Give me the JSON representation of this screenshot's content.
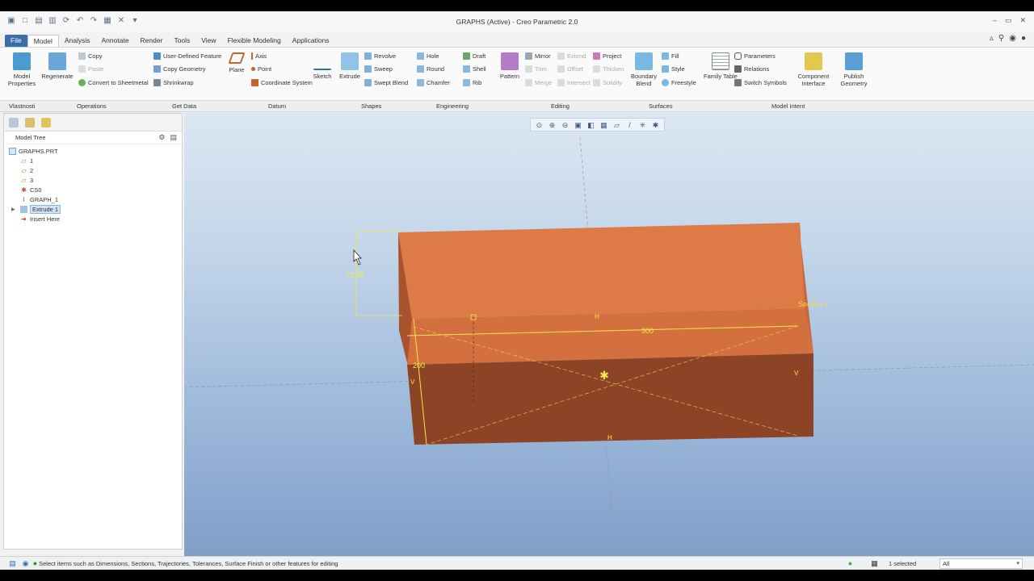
{
  "window": {
    "title": "GRAPHS (Active) - Creo Parametric 2.0"
  },
  "tabs": [
    "File",
    "Model",
    "Analysis",
    "Annotate",
    "Render",
    "Tools",
    "View",
    "Flexible Modeling",
    "Applications"
  ],
  "ribbon": {
    "model_properties": "Model Properties",
    "regenerate": "Regenerate",
    "copy": "Copy",
    "paste": "Paste",
    "user_defined_feature": "User-Defined Feature",
    "copy_geometry": "Copy Geometry",
    "shrinkwrap": "Shrinkwrap",
    "convert_to_sheetmetal": "Convert to Sheetmetal",
    "plane": "Plane",
    "axis": "Axis",
    "point": "Point",
    "coordinate_system": "Coordinate System",
    "sketch": "Sketch",
    "extrude": "Extrude",
    "revolve": "Revolve",
    "sweep": "Sweep",
    "swept_blend": "Swept Blend",
    "hole": "Hole",
    "round": "Round",
    "chamfer": "Chamfer",
    "draft": "Draft",
    "shell": "Shell",
    "rib": "Rib",
    "pattern": "Pattern",
    "mirror": "Mirror",
    "trim": "Trim",
    "merge": "Merge",
    "extend": "Extend",
    "offset": "Offset",
    "intersect": "Intersect",
    "project": "Project",
    "thicken": "Thicken",
    "solidify": "Solidify",
    "boundary_blend": "Boundary Blend",
    "fill": "Fill",
    "style": "Style",
    "freestyle": "Freestyle",
    "family_table": "Family Table",
    "parameters": "Parameters",
    "relations": "Relations",
    "switch_symbols": "Switch Symbols",
    "component_interface": "Component Interface",
    "publish_geometry": "Publish Geometry"
  },
  "groups": [
    "Vlastnosti",
    "Operations",
    "Get Data",
    "Datum",
    "Shapes",
    "Engineering",
    "Editing",
    "Surfaces",
    "Model Intent"
  ],
  "model_tree": {
    "header": "Model Tree",
    "items": [
      "GRAPHS.PRT",
      "1",
      "2",
      "3",
      "CS0",
      "GRAPH_1",
      "Extrude 1",
      "Insert Here"
    ]
  },
  "viewport": {
    "dim_height": "72.28",
    "dim_width": "300",
    "dim_depth": "200",
    "section_label": "Section 1",
    "h": "H",
    "v": "V"
  },
  "status": {
    "message": "Select items such as Dimensions, Sections, Trajectories, Tolerances, Surface Finish or other features for editing",
    "selected": "1 selected",
    "filter": "All"
  },
  "colors": {
    "part_top": "#de7a45",
    "part_front": "#8d4326",
    "dimension": "#f5e84a",
    "accent": "#3a6ea8"
  }
}
